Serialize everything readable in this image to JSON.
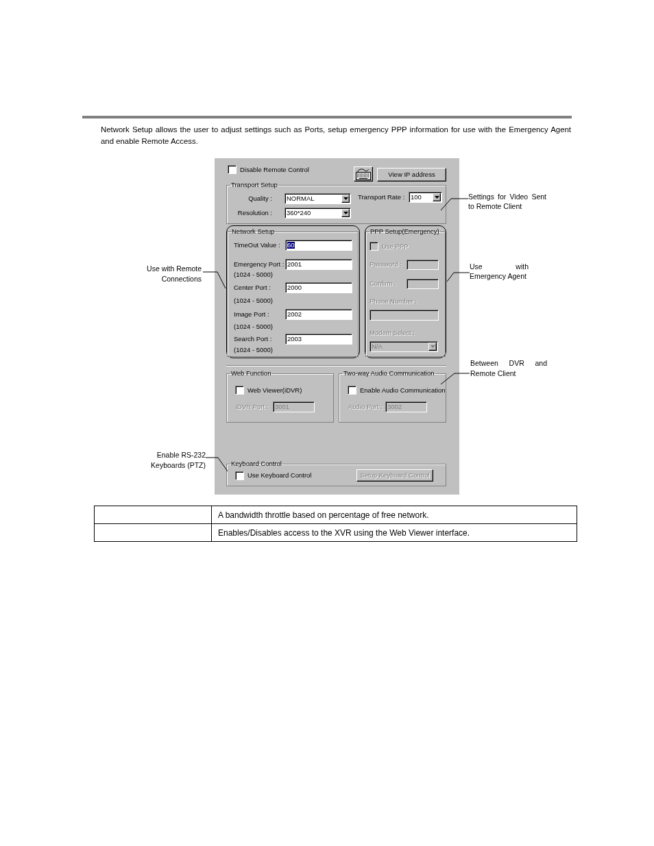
{
  "intro": "Network Setup allows the user to adjust settings such as Ports, setup emergency PPP information for use with the Emergency Agent and enable Remote Access.",
  "dialog": {
    "disable_remote_control": {
      "label": "Disable Remote Control",
      "checked": false
    },
    "view_ip_button": {
      "label": "View IP address"
    },
    "transport_setup": {
      "title": "Transport Setup",
      "quality": {
        "label": "Quality :",
        "value": "NORMAL"
      },
      "resolution": {
        "label": "Resolution :",
        "value": "360*240"
      },
      "transport_rate": {
        "label": "Transport Rate :",
        "value": "100"
      }
    },
    "network_setup": {
      "title": "Network Setup",
      "fields": [
        {
          "label": "TimeOut Value :",
          "value": "60",
          "selected": true
        },
        {
          "label": "Emergency Port :",
          "value": "2001",
          "range": "(1024 - 5000)",
          "selected": false
        },
        {
          "label": "Center Port :",
          "value": "2000",
          "range": "(1024 - 5000)",
          "selected": false
        },
        {
          "label": "Image Port :",
          "value": "2002",
          "range": "(1024 - 5000)",
          "selected": false
        },
        {
          "label": "Search Port :",
          "value": "2003",
          "range": "(1024 - 5000)",
          "selected": false
        }
      ]
    },
    "ppp_setup": {
      "title": "PPP Setup(Emergency)",
      "disabled": true,
      "use_ppp": {
        "label": "Use PPP",
        "checked": false
      },
      "fields": [
        {
          "kind": "short",
          "label": "Password :"
        },
        {
          "kind": "short",
          "label": "Confirm :"
        },
        {
          "kind": "wide",
          "label": "Phone Number :"
        },
        {
          "kind": "select",
          "label": "Modem Select :",
          "value": "N/A"
        }
      ]
    },
    "web_function": {
      "title": "Web Function",
      "enable": {
        "label": "Web Viewer(iDVR)",
        "checked": false
      },
      "port": {
        "label": "iDVR Port :",
        "value": "3001",
        "disabled": true
      }
    },
    "audio": {
      "title": "Two-way Audio Communication",
      "enable": {
        "label": "Enable Audio Communication",
        "checked": false
      },
      "port": {
        "label": "Audio Port :",
        "value": "3002",
        "disabled": true
      }
    },
    "keyboard_control": {
      "title": "Keyboard Control",
      "enable": {
        "label": "Use Keyboard Control",
        "checked": false
      },
      "setup_button": {
        "label": "Setup Keyboard Control",
        "disabled": true
      }
    }
  },
  "callouts": [
    {
      "text": "Settings for Video Sent to Remote Client"
    },
    {
      "text": "Use with Remote Connections"
    },
    {
      "text": "Use with Emergency Agent"
    },
    {
      "text": "Between DVR and Remote Client"
    },
    {
      "text": "Enable RS-232 Keyboards (PTZ)"
    }
  ],
  "table": {
    "rows": [
      {
        "column_2": "A bandwidth throttle based on percentage of free network."
      },
      {
        "column_2": "Enables/Disables access to the XVR using the Web Viewer interface."
      }
    ]
  }
}
